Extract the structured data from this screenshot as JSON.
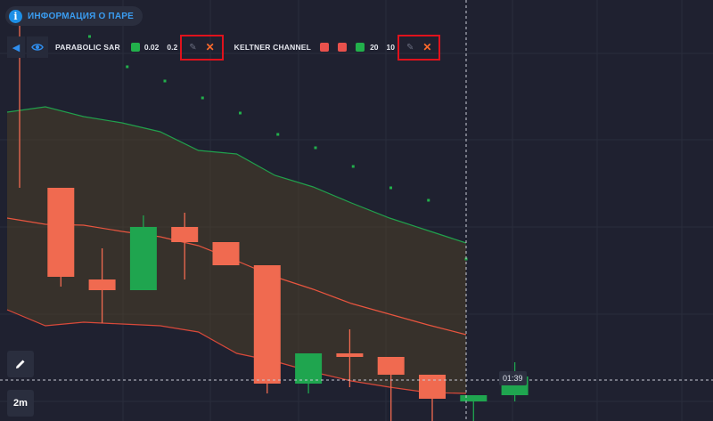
{
  "info": {
    "label": "ИНФОРМАЦИЯ О ПАРЕ",
    "icon": "info-icon"
  },
  "indicators": [
    {
      "name": "PARABOLIC SAR",
      "swatches": [
        "#22b04b"
      ],
      "params": [
        "0.02",
        "0.2"
      ]
    },
    {
      "name": "KELTNER CHANNEL",
      "swatches": [
        "#e9514c",
        "#e9514c",
        "#22b04b"
      ],
      "params": [
        "20",
        "10"
      ]
    }
  ],
  "controls": {
    "edit_icon": "pencil-icon",
    "remove_icon": "close-icon"
  },
  "crosshair_time": "01:39",
  "period": "2m",
  "colors": {
    "bull": "#1fa54f",
    "bear": "#f06a50",
    "keltner_upper": "#21a04c",
    "keltner_mid": "#e8553f",
    "keltner_lower": "#d9493a",
    "sar": "#22b04b"
  },
  "chart_data": {
    "type": "candlestick",
    "y_scale": "unlabeled",
    "candles": [
      {
        "open": 262,
        "close": 262,
        "high": 452,
        "low": 262,
        "dir": "flat"
      },
      {
        "open": 262,
        "close": 162,
        "high": 262,
        "low": 151,
        "dir": "bear"
      },
      {
        "open": 159,
        "close": 147,
        "high": 194,
        "low": 110,
        "dir": "bear"
      },
      {
        "open": 147,
        "close": 218,
        "high": 231,
        "low": 147,
        "dir": "bull"
      },
      {
        "open": 218,
        "close": 201,
        "high": 234,
        "low": 159,
        "dir": "bear"
      },
      {
        "open": 201,
        "close": 175,
        "high": 201,
        "low": 175,
        "dir": "bear"
      },
      {
        "open": 175,
        "close": 42,
        "high": 175,
        "low": 31,
        "dir": "bear"
      },
      {
        "open": 42,
        "close": 76,
        "high": 76,
        "low": 31,
        "dir": "bull"
      },
      {
        "open": 76,
        "close": 72,
        "high": 103,
        "low": 38,
        "dir": "bear"
      },
      {
        "open": 72,
        "close": 52,
        "high": 72,
        "low": 0,
        "dir": "bear"
      },
      {
        "open": 52,
        "close": 25,
        "high": 52,
        "low": 0,
        "dir": "bear"
      },
      {
        "open": 22,
        "close": 29,
        "high": 29,
        "low": 0,
        "dir": "bull"
      },
      {
        "open": 29,
        "close": 50,
        "high": 66,
        "low": 22,
        "dir": "bull"
      }
    ],
    "keltner": {
      "upper": [
        347,
        353,
        342,
        335,
        325,
        304,
        300,
        276,
        263,
        245,
        228,
        214,
        200
      ],
      "middle": [
        228,
        221,
        220,
        213,
        207,
        197,
        180,
        162,
        148,
        132,
        120,
        108,
        97
      ],
      "lower": [
        125,
        107,
        111,
        109,
        107,
        100,
        76,
        67,
        55,
        45,
        38,
        32,
        31
      ]
    },
    "sar": [
      477,
      456,
      432,
      398,
      382,
      363,
      346,
      322,
      307,
      286,
      262,
      248,
      182
    ],
    "crosshair_level": 46
  }
}
